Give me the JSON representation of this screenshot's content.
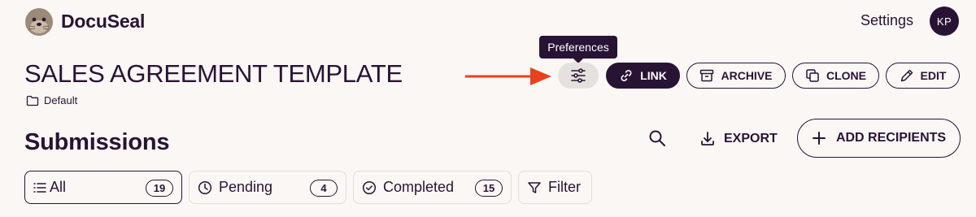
{
  "app": {
    "brand": "DocuSeal"
  },
  "header": {
    "settings_label": "Settings",
    "avatar_initials": "KP"
  },
  "template": {
    "title": "SALES AGREEMENT TEMPLATE",
    "folder": "Default"
  },
  "tooltip": {
    "text": "Preferences"
  },
  "toolbar": {
    "link_label": "LINK",
    "archive_label": "ARCHIVE",
    "clone_label": "CLONE",
    "edit_label": "EDIT"
  },
  "submissions": {
    "title": "Submissions",
    "export_label": "EXPORT",
    "add_recipients_label": "ADD RECIPIENTS"
  },
  "filters": {
    "all": {
      "label": "All",
      "count": "19"
    },
    "pending": {
      "label": "Pending",
      "count": "4"
    },
    "completed": {
      "label": "Completed",
      "count": "15"
    },
    "filter_label": "Filter"
  },
  "colors": {
    "primary": "#291334",
    "background": "#faf7f5",
    "arrow": "#e8411e"
  }
}
